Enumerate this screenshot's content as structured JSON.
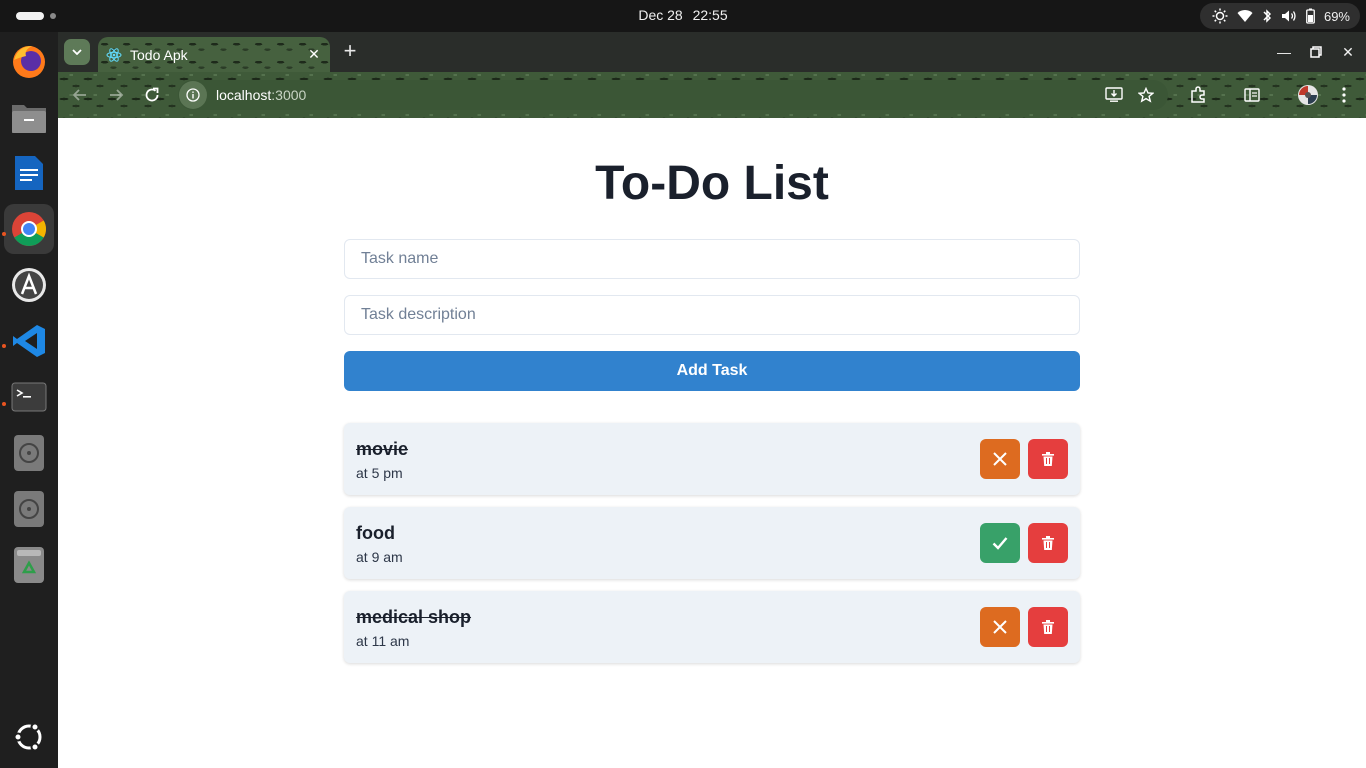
{
  "system": {
    "date": "Dec 28",
    "time": "22:55",
    "battery": "69%"
  },
  "browser": {
    "tab_title": "Todo Apk",
    "url_host": "localhost",
    "url_port": ":3000"
  },
  "app": {
    "title": "To-Do List",
    "task_name_placeholder": "Task name",
    "task_description_placeholder": "Task description",
    "add_button_label": "Add Task",
    "tasks": [
      {
        "name": "movie",
        "description": "at 5 pm",
        "completed": true
      },
      {
        "name": "food",
        "description": "at 9 am",
        "completed": false
      },
      {
        "name": "medical shop",
        "description": "at 11 am",
        "completed": true
      }
    ]
  },
  "colors": {
    "primary": "#3182ce",
    "undo": "#dd6b20",
    "complete": "#38a169",
    "delete": "#e53e3e"
  },
  "dock": [
    "firefox-icon",
    "files-icon",
    "writer-icon",
    "chrome-icon",
    "app-center-icon",
    "vscode-icon",
    "terminal-icon",
    "disc-icon",
    "disc-icon",
    "trash-icon",
    "ubuntu-logo-icon"
  ]
}
